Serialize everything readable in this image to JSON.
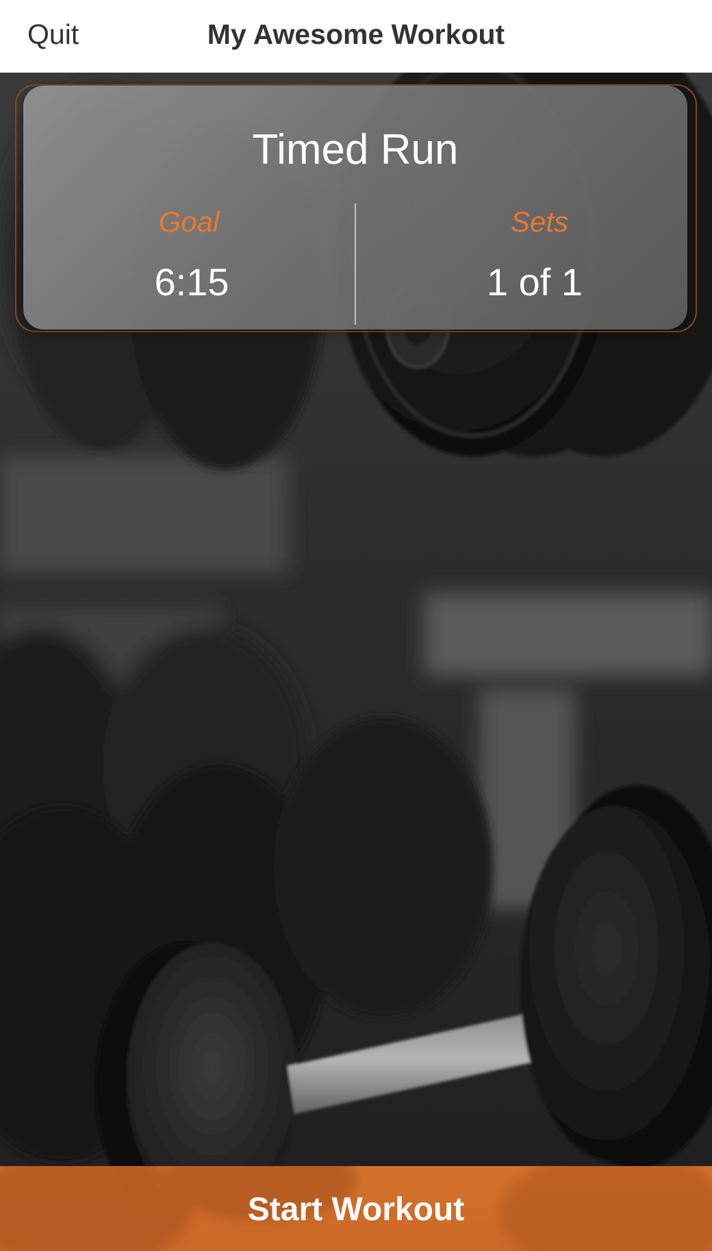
{
  "navbar": {
    "quit_label": "Quit",
    "title": "My Awesome Workout"
  },
  "exercise_card": {
    "name": "Timed Run",
    "goal_label": "Goal",
    "goal_value": "6:15",
    "sets_label": "Sets",
    "sets_value": "1 of 1"
  },
  "start_button": {
    "label": "Start Workout"
  },
  "colors": {
    "accent": "#e8782e",
    "button": "#d96f2a",
    "navbar_bg": "#ffffff",
    "text_dark": "#333333"
  },
  "background": {
    "icon": "dumbbell-rack-photo"
  }
}
